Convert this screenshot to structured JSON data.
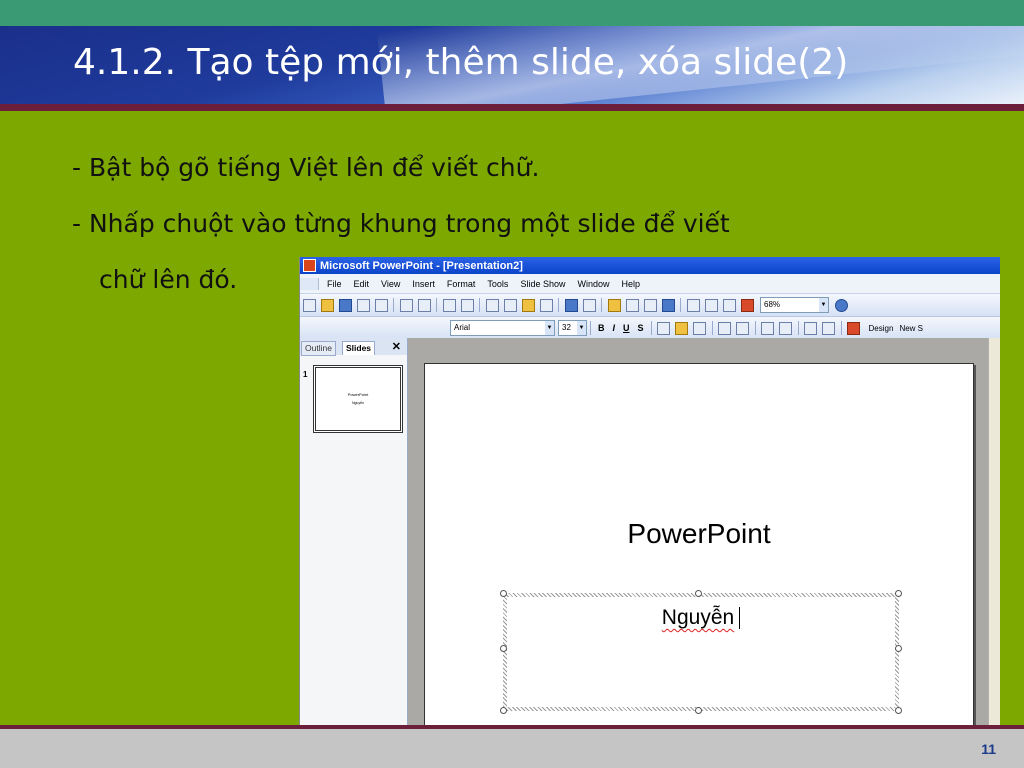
{
  "slide": {
    "title": "4.1.2. Tạo tệp mới, thêm slide, xóa slide(2)",
    "bullets": [
      "- Bật bộ gõ tiếng Việt lên để viết chữ.",
      "- Nhấp chuột vào từng khung trong một slide để viết",
      "chữ lên đó."
    ],
    "page_number": "11"
  },
  "ppt": {
    "window_title": "Microsoft PowerPoint - [Presentation2]",
    "menu": [
      "File",
      "Edit",
      "View",
      "Insert",
      "Format",
      "Tools",
      "Slide Show",
      "Window",
      "Help"
    ],
    "zoom": "68%",
    "font": "Arial",
    "font_size": "32",
    "format_buttons": [
      "B",
      "I",
      "U",
      "S"
    ],
    "design_label": "Design",
    "new_slide_label": "New S",
    "tabs": {
      "outline": "Outline",
      "slides": "Slides"
    },
    "thumb": {
      "number": "1",
      "title": "PowerPoint",
      "subtitle": "Nguyễn"
    },
    "slide_heading": "PowerPoint",
    "typed_text": "Nguyễn"
  }
}
